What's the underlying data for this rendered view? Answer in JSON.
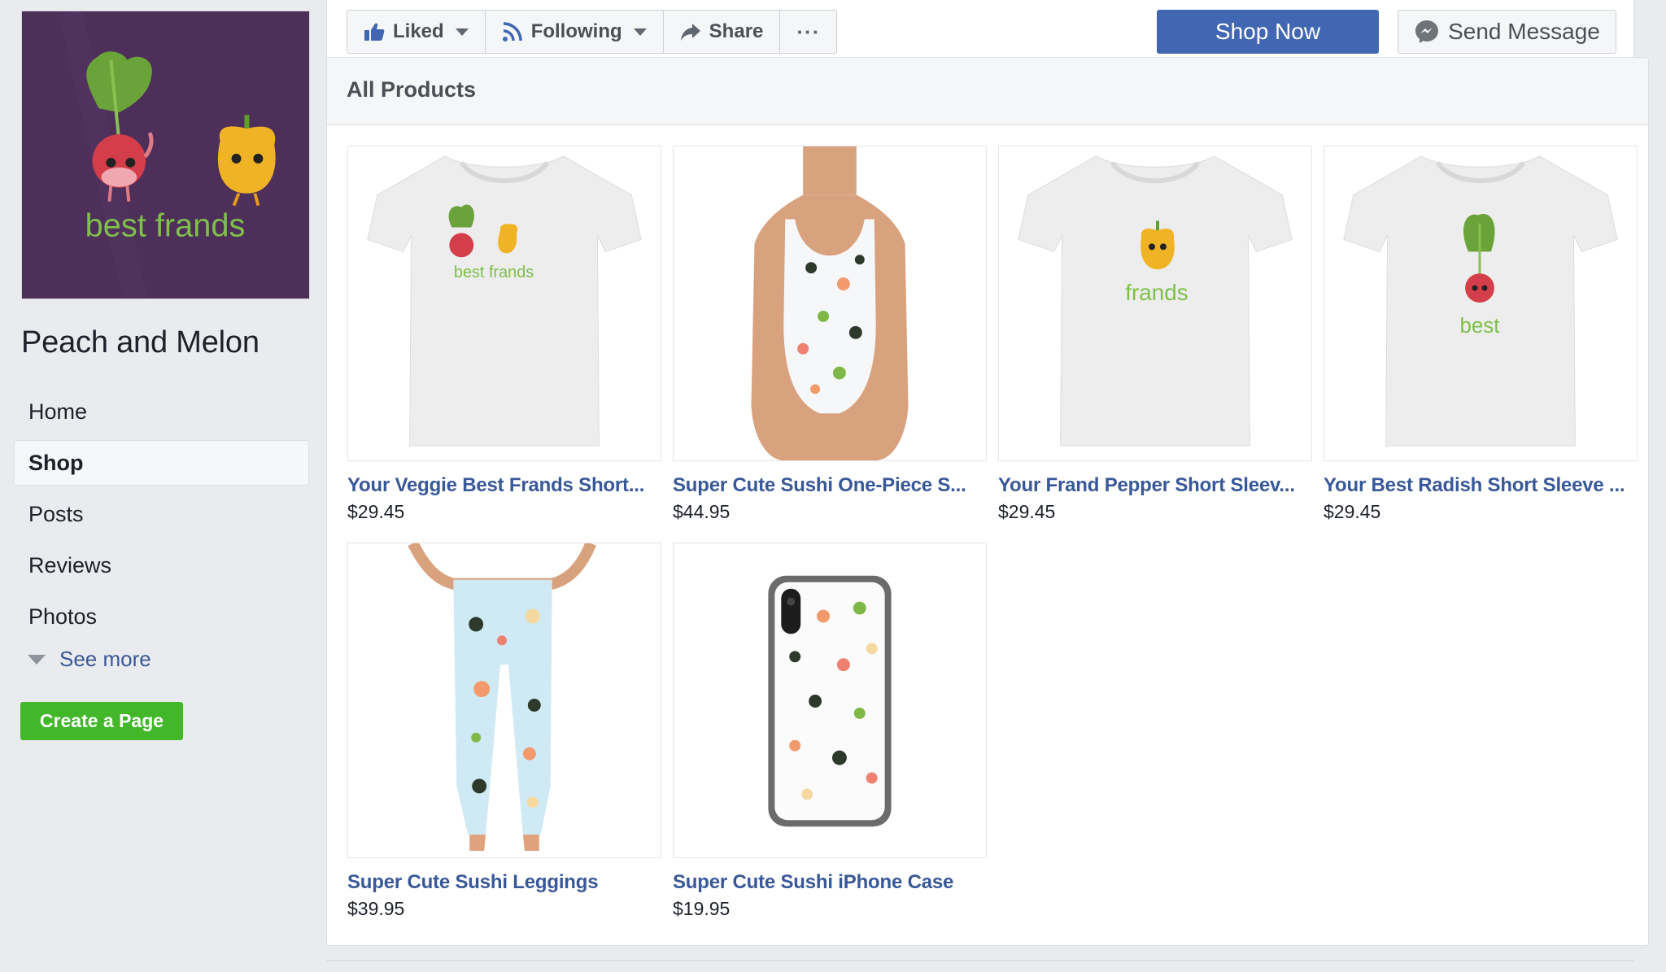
{
  "page": {
    "name": "Peach and Melon",
    "profile_image_alt": "best frands",
    "profile_image_text": "best frands"
  },
  "sidebar": {
    "items": [
      {
        "label": "Home",
        "active": false
      },
      {
        "label": "Shop",
        "active": true
      },
      {
        "label": "Posts",
        "active": false
      },
      {
        "label": "Reviews",
        "active": false
      },
      {
        "label": "Photos",
        "active": false
      }
    ],
    "see_more": "See more",
    "create_page": "Create a Page"
  },
  "actions": {
    "liked": "Liked",
    "following": "Following",
    "share": "Share",
    "more": "···",
    "shop_now": "Shop Now",
    "send_message": "Send Message"
  },
  "products_panel": {
    "header": "All Products",
    "products": [
      {
        "title": "Your Veggie Best Frands Short...",
        "price": "$29.45",
        "image": "tshirt-best-frands",
        "print_text": "best frands"
      },
      {
        "title": "Super Cute Sushi One-Piece S...",
        "price": "$44.95",
        "image": "sushi-swimsuit"
      },
      {
        "title": "Your Frand Pepper Short Sleev...",
        "price": "$29.45",
        "image": "tshirt-pepper",
        "print_text": "frands"
      },
      {
        "title": "Your Best Radish Short Sleeve ...",
        "price": "$29.45",
        "image": "tshirt-radish",
        "print_text": "best"
      },
      {
        "title": "Super Cute Sushi Leggings",
        "price": "$39.95",
        "image": "sushi-leggings"
      },
      {
        "title": "Super Cute Sushi iPhone Case",
        "price": "$19.95",
        "image": "sushi-phone-case"
      }
    ]
  },
  "colors": {
    "brand_blue": "#4267b2",
    "link_blue": "#385898",
    "create_green": "#42b72a",
    "background": "#e9ebee",
    "profile_purple": "#4e2f5a"
  }
}
